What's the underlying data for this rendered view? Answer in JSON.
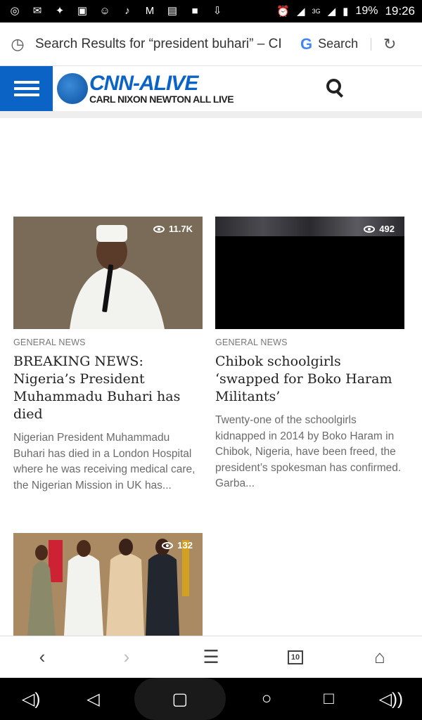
{
  "status": {
    "battery": "19%",
    "time": "19:26",
    "network": "3G"
  },
  "address_bar": {
    "url_text": "Search Results for “president buhari” – CI",
    "search_label": "Search"
  },
  "site": {
    "logo_title": "CNN-ALIVE",
    "logo_subtitle": "CARL NIXON NEWTON ALL LIVE"
  },
  "articles": [
    {
      "views": "11.7K",
      "category": "GENERAL NEWS",
      "title": "BREAKING NEWS: Nigeria’s President Muhammadu Buhari has died",
      "excerpt": "Nigerian President Muhammadu Buhari has died in a London Hospital where he was receiving medical care, the Nigerian Mission in UK has..."
    },
    {
      "views": "492",
      "category": "GENERAL NEWS",
      "title": "Chibok schoolgirls ‘swapped for Boko Haram Militants’",
      "excerpt": "Twenty-one of the schoolgirls kidnapped in 2014 by Boko Haram in Chibok, Nigeria, have been freed, the president’s spokesman has confirmed. Garba..."
    },
    {
      "views": "132"
    }
  ],
  "browser_bar": {
    "tab_count": "10"
  },
  "colors": {
    "brand": "#0b63c6"
  }
}
